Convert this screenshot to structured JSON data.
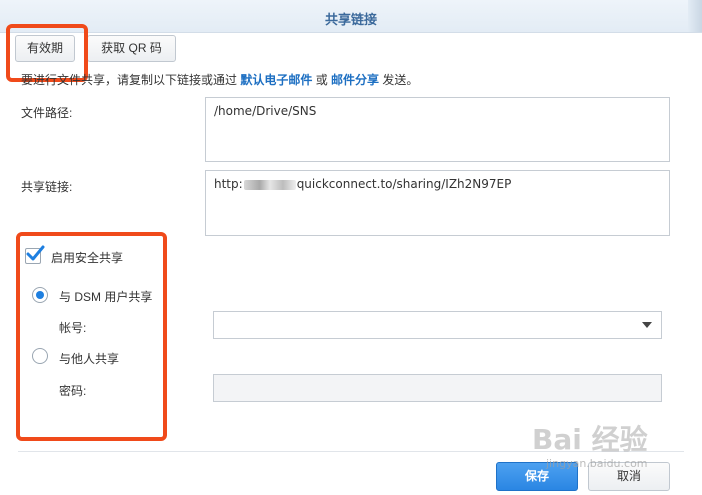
{
  "dialog": {
    "title": "共享链接"
  },
  "tabs": {
    "validity": "有效期",
    "qr": "获取 QR 码"
  },
  "instructions": {
    "prefix": "要进行文件共享，请复制以下链接或通过 ",
    "email_default": "默认电子邮件",
    "or": " 或 ",
    "email_share": "邮件分享",
    "suffix": " 发送。"
  },
  "file_path": {
    "label": "文件路径:",
    "value": "/home/Drive/SNS"
  },
  "share_link": {
    "label": "共享链接:",
    "prefix": "http:",
    "suffix": "quickconnect.to/sharing/IZh2N97EP"
  },
  "secure_sharing": {
    "checkbox_label": "启用安全共享",
    "checked": true,
    "option_dsm": "与 DSM 用户共享",
    "account_label": "帐号:",
    "option_others": "与他人共享",
    "password_label": "密码:"
  },
  "footer": {
    "save": "保存",
    "cancel": "取消"
  },
  "watermark": {
    "main": "Bai 经验",
    "sub": "jingyan.baidu.com"
  },
  "colors": {
    "accent": "#1e7fe0",
    "highlight": "#f04a1a",
    "link": "#1d6fc2"
  }
}
